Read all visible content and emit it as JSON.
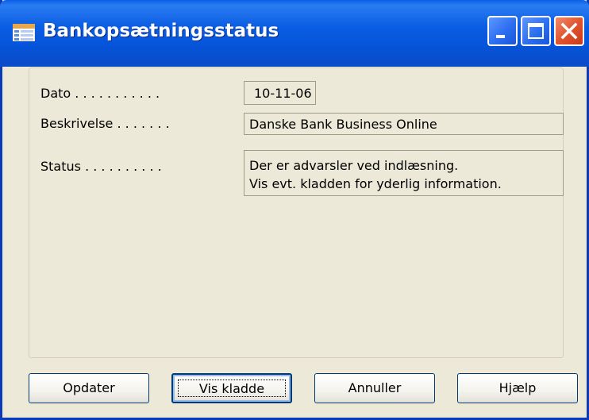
{
  "window": {
    "title": "Bankopsætningsstatus",
    "icon": "table-window-icon",
    "controls": [
      "minimize-icon",
      "maximize-icon",
      "close-icon"
    ]
  },
  "form": {
    "dato_label": "Dato . . . . . . . . . . .",
    "dato_value": "10-11-06",
    "beskrivelse_label": "Beskrivelse . . . . . . .",
    "beskrivelse_value": "Danske Bank Business Online",
    "status_label": "Status . . . . . . . . . .",
    "status_line1": "Der er advarsler ved indlæsning.",
    "status_line2": "Vis evt. kladden for yderlig information."
  },
  "buttons": {
    "opdater": "Opdater",
    "vis_kladde": "Vis kladde",
    "annuller": "Annuller",
    "hjaelp": "Hjælp"
  },
  "colors": {
    "titlebar": "#0a5fe8",
    "window_bg": "#ece9d8",
    "close_button": "#e0502c"
  }
}
